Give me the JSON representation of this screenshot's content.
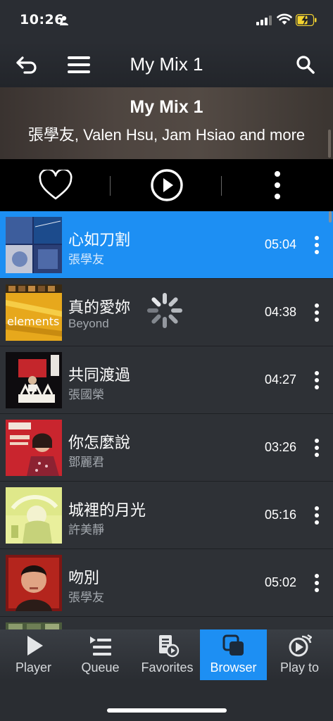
{
  "status_bar": {
    "time": "10:26"
  },
  "nav": {
    "title": "My Mix 1"
  },
  "header": {
    "title": "My Mix 1",
    "subtitle": "張學友, Valen Hsu, Jam Hsiao and more"
  },
  "tracks": [
    {
      "title": "心如刀割",
      "artist": "張學友",
      "duration": "05:04",
      "active": true
    },
    {
      "title": "真的愛妳",
      "artist": "Beyond",
      "duration": "04:38",
      "active": false,
      "loading": true,
      "cover_text": "elements"
    },
    {
      "title": "共同渡過",
      "artist": "張國榮",
      "duration": "04:27",
      "active": false
    },
    {
      "title": "你怎麼說",
      "artist": "鄧麗君",
      "duration": "03:26",
      "active": false
    },
    {
      "title": "城裡的月光",
      "artist": "許美靜",
      "duration": "05:16",
      "active": false
    },
    {
      "title": "吻別",
      "artist": "張學友",
      "duration": "05:02",
      "active": false
    }
  ],
  "tabs": [
    {
      "label": "Player",
      "icon": "play-icon"
    },
    {
      "label": "Queue",
      "icon": "queue-icon"
    },
    {
      "label": "Favorites",
      "icon": "favorites-icon"
    },
    {
      "label": "Browser",
      "icon": "browser-icon",
      "active": true
    },
    {
      "label": "Play to",
      "icon": "play-to-icon"
    }
  ],
  "colors": {
    "accent": "#1d8ff3",
    "background": "#2e3136",
    "action_bar": "#000000"
  }
}
